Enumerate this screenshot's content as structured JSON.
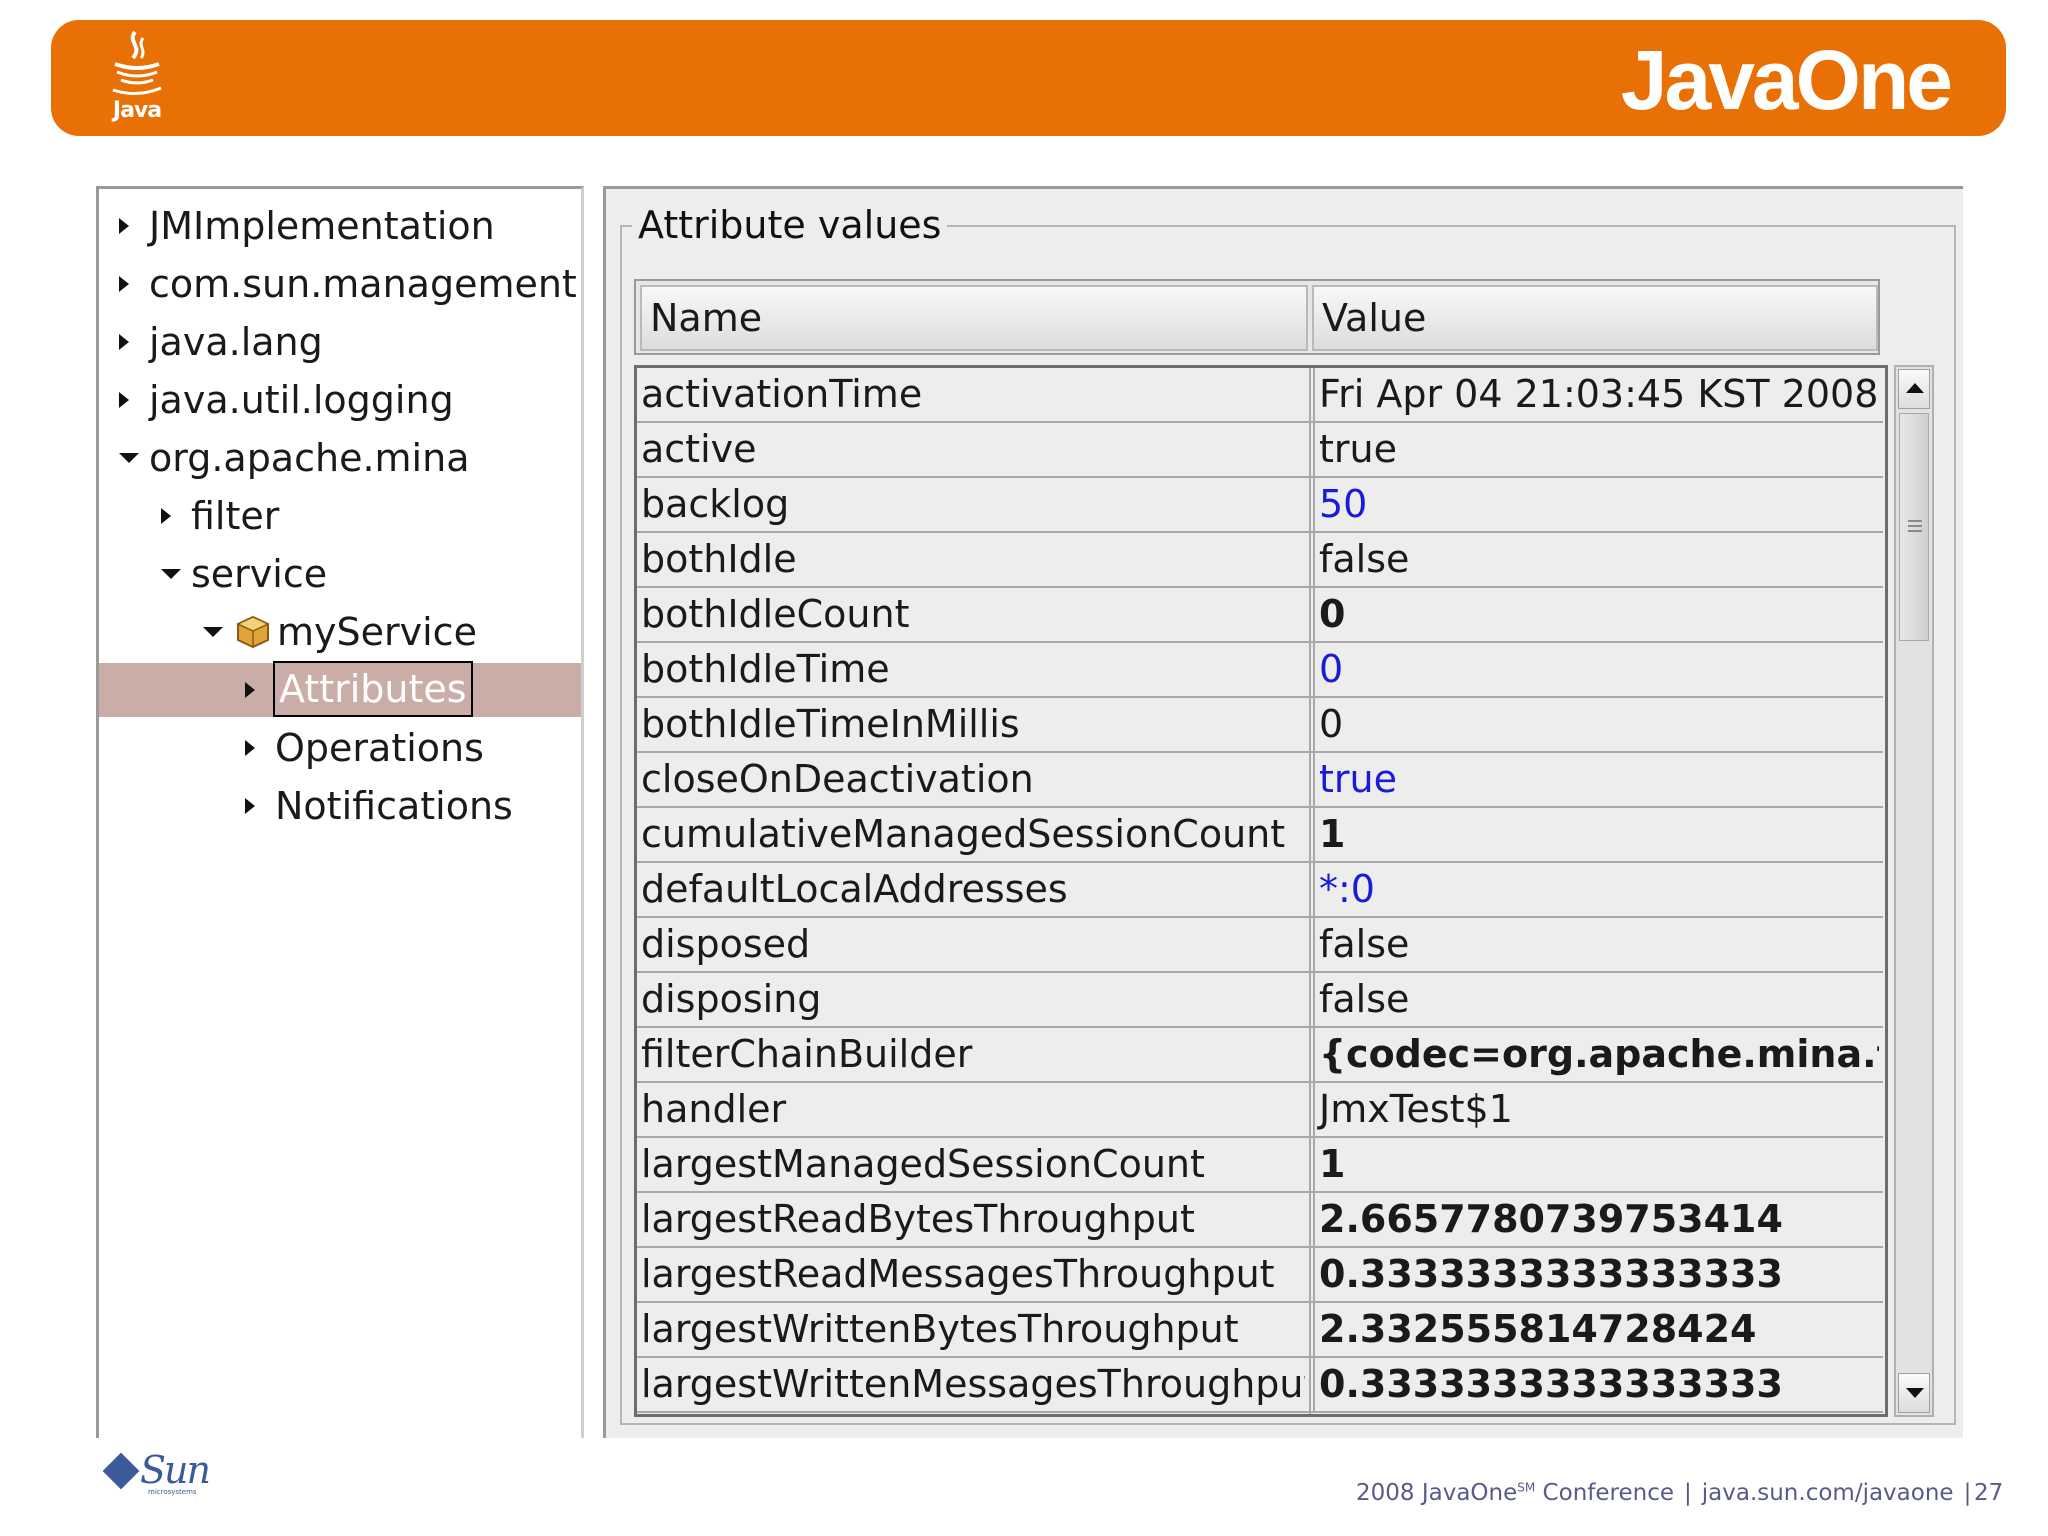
{
  "slide": {
    "logo_text": "Java",
    "brand": "JavaOne",
    "footer_year_prefix": "2008 JavaOne",
    "footer_sm": "SM",
    "footer_conference": " Conference",
    "footer_separator": "|",
    "footer_url": "java.sun.com/javaone",
    "page_number": "27",
    "sun_logo_text": "Sun",
    "sun_logo_sub": "microsystems",
    "accent_color": "#e87005"
  },
  "tree": {
    "items": [
      {
        "label": "JMImplementation",
        "state": "collapsed"
      },
      {
        "label": "com.sun.management",
        "state": "collapsed"
      },
      {
        "label": "java.lang",
        "state": "collapsed"
      },
      {
        "label": "java.util.logging",
        "state": "collapsed"
      },
      {
        "label": "org.apache.mina",
        "state": "expanded"
      },
      {
        "label": "filter",
        "state": "collapsed"
      },
      {
        "label": "service",
        "state": "expanded"
      },
      {
        "label": "myService",
        "state": "expanded",
        "icon": "bean-icon"
      },
      {
        "label": "Attributes",
        "state": "collapsed",
        "selected": true
      },
      {
        "label": "Operations",
        "state": "collapsed"
      },
      {
        "label": "Notifications",
        "state": "collapsed"
      }
    ]
  },
  "attributes": {
    "legend": "Attribute values",
    "columns": {
      "name": "Name",
      "value": "Value"
    },
    "rows": [
      {
        "name": "activationTime",
        "value": "Fri Apr 04 21:03:45 KST 2008",
        "style": "plain"
      },
      {
        "name": "active",
        "value": "true",
        "style": "plain"
      },
      {
        "name": "backlog",
        "value": "50",
        "style": "blue"
      },
      {
        "name": "bothIdle",
        "value": "false",
        "style": "plain"
      },
      {
        "name": "bothIdleCount",
        "value": "0",
        "style": "bold"
      },
      {
        "name": "bothIdleTime",
        "value": "0",
        "style": "blue"
      },
      {
        "name": "bothIdleTimeInMillis",
        "value": "0",
        "style": "plain"
      },
      {
        "name": "closeOnDeactivation",
        "value": "true",
        "style": "blue"
      },
      {
        "name": "cumulativeManagedSessionCount",
        "value": "1",
        "style": "bold"
      },
      {
        "name": "defaultLocalAddresses",
        "value": "*:0",
        "style": "blue"
      },
      {
        "name": "disposed",
        "value": "false",
        "style": "plain"
      },
      {
        "name": "disposing",
        "value": "false",
        "style": "plain"
      },
      {
        "name": "filterChainBuilder",
        "value": "{codec=org.apache.mina.filt...",
        "style": "bold"
      },
      {
        "name": "handler",
        "value": "JmxTest$1",
        "style": "plain"
      },
      {
        "name": "largestManagedSessionCount",
        "value": "1",
        "style": "bold"
      },
      {
        "name": "largestReadBytesThroughput",
        "value": "2.6657780739753414",
        "style": "bold"
      },
      {
        "name": "largestReadMessagesThroughput",
        "value": "0.3333333333333333",
        "style": "bold"
      },
      {
        "name": "largestWrittenBytesThroughput",
        "value": "2.332555814728424",
        "style": "bold"
      },
      {
        "name": "largestWrittenMessagesThroughput",
        "value": "0.3333333333333333",
        "style": "bold"
      }
    ]
  }
}
